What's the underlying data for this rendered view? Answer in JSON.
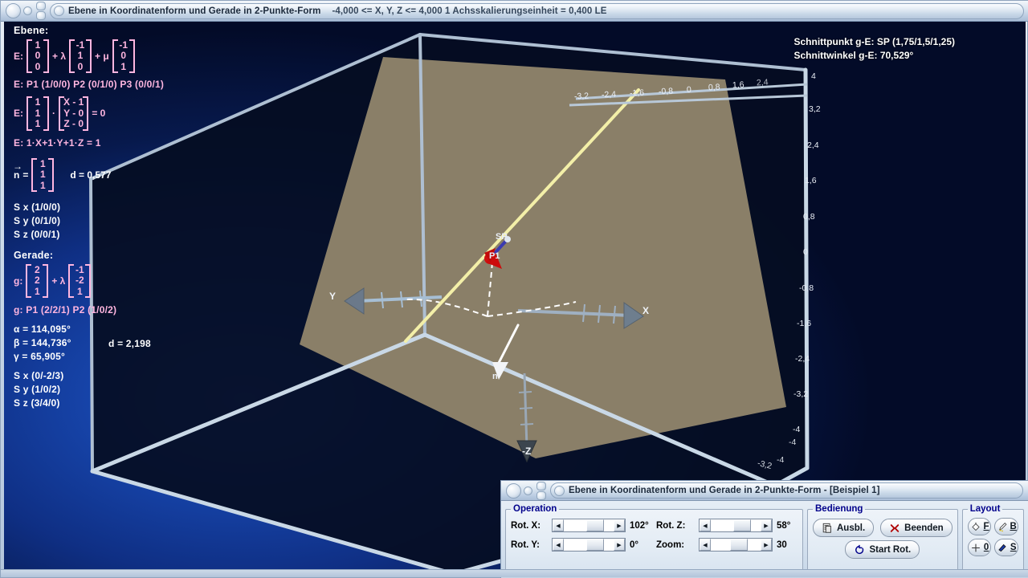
{
  "window": {
    "title": "Ebene in Koordinatenform und Gerade in 2-Punkte-Form",
    "subtitle": "-4,000 <= X, Y, Z <= 4,000    1 Achsskalierungseinheit = 0,400 LE"
  },
  "panel": {
    "plane_heading": "Ebene:",
    "plane_param_prefix": "E:",
    "plane_point_vec": [
      "1",
      "0",
      "0"
    ],
    "plane_dir1_sym": "+ λ",
    "plane_dir1_vec": [
      "-1",
      "1",
      "0"
    ],
    "plane_dir2_sym": "+ μ",
    "plane_dir2_vec": [
      "-1",
      "0",
      "1"
    ],
    "plane_points_line": "E: P1 (1/0/0)   P2 (0/1/0)   P3 (0/0/1)",
    "plane_normal_prefix": "E:",
    "plane_normal_vec": [
      "1",
      "1",
      "1"
    ],
    "plane_dot": "·",
    "plane_coord_vec": [
      "X - 1",
      "Y - 0",
      "Z - 0"
    ],
    "plane_eq_zero": "= 0",
    "plane_coord_eq": "E: 1·X+1·Y+1·Z = 1",
    "normal_label": "n",
    "normal_eq": "=",
    "normal_vec": [
      "1",
      "1",
      "1"
    ],
    "plane_distance": "d = 0,577",
    "plane_sx": "S x (1/0/0)",
    "plane_sy": "S y (0/1/0)",
    "plane_sz": "S z (0/0/1)",
    "line_heading": "Gerade:",
    "line_prefix": "g:",
    "line_point_vec": [
      "2",
      "2",
      "1"
    ],
    "line_dir_sym": "+ λ",
    "line_dir_vec": [
      "-1",
      "-2",
      "1"
    ],
    "line_points": "g: P1 (2/2/1)   P2 (1/0/2)",
    "alpha": "α = 114,095°",
    "beta": "β = 144,736°",
    "gamma": "γ =  65,905°",
    "line_distance": "d = 2,198",
    "line_sx": "S x (0/-2/3)",
    "line_sy": "S y (1/0/2)",
    "line_sz": "S z (3/4/0)"
  },
  "results": {
    "intersection_point": "Schnittpunkt g-E: SP (1,75/1,5/1,25)",
    "intersection_angle": "Schnittwinkel g-E: 70,529°"
  },
  "scene": {
    "axis_x_label": "X",
    "axis_y_label": "Y",
    "axis_z_label": "-Z",
    "point_p1_label": "P1",
    "point_sp_label": "SP",
    "normal_vec_label": "n",
    "top_ticks": [
      "-3,2",
      "-2,4",
      "-1,6",
      "-0,8",
      "0",
      "0,8",
      "1,6",
      "2,4"
    ],
    "right_ticks": [
      "4",
      "3,2",
      "2,4",
      "1,6",
      "0,8",
      "0",
      "-0,8",
      "-1,6",
      "-2,4",
      "-3,2",
      "-4"
    ],
    "bottom_right_ticks": [
      "-3,2",
      "-4",
      "-4"
    ],
    "colors": {
      "plane_fill": "#8a7f68",
      "line_color": "#f3efa8",
      "point_color": "#d01010",
      "sp_vector_color": "#3a3ab0",
      "wire_color": "#b9c9da",
      "background_blue": "#1746ad"
    }
  },
  "dialog": {
    "title": "Ebene in Koordinatenform und Gerade in 2-Punkte-Form - [Beispiel 1]",
    "operation": {
      "legend": "Operation",
      "controls": [
        {
          "label": "Rot. X:",
          "value": "102°"
        },
        {
          "label": "Rot. Z:",
          "value": "58°"
        },
        {
          "label": "Rot. Y:",
          "value": "0°"
        },
        {
          "label": "Zoom:",
          "value": "30"
        }
      ]
    },
    "bedienung": {
      "legend": "Bedienung",
      "btn_ausbl": "Ausbl.",
      "btn_beenden": "Beenden",
      "btn_start_rot": "Start Rot."
    },
    "layout": {
      "legend": "Layout",
      "buttons": [
        "F",
        "B",
        "0",
        "S"
      ]
    }
  }
}
